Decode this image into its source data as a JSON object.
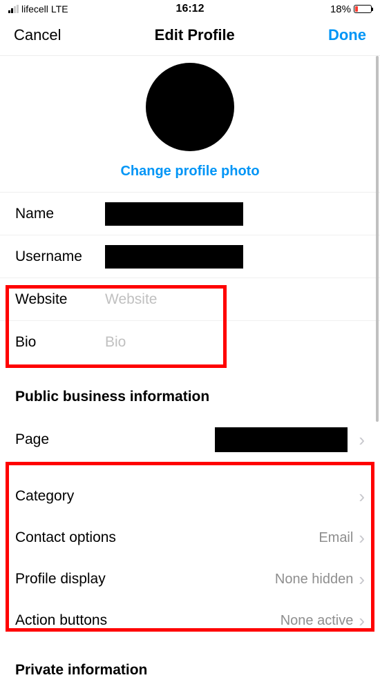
{
  "status": {
    "carrier": "lifecell",
    "network": "LTE",
    "time": "16:12",
    "battery_pct": "18%"
  },
  "nav": {
    "cancel": "Cancel",
    "title": "Edit Profile",
    "done": "Done"
  },
  "avatar": {
    "change_label": "Change profile photo"
  },
  "fields": {
    "name_label": "Name",
    "username_label": "Username",
    "website_label": "Website",
    "website_placeholder": "Website",
    "bio_label": "Bio",
    "bio_placeholder": "Bio"
  },
  "business": {
    "section_title": "Public business information",
    "page_label": "Page",
    "category_label": "Category",
    "contact_label": "Contact options",
    "contact_value": "Email",
    "display_label": "Profile display",
    "display_value": "None hidden",
    "action_label": "Action buttons",
    "action_value": "None active"
  },
  "private": {
    "section_title": "Private information"
  }
}
